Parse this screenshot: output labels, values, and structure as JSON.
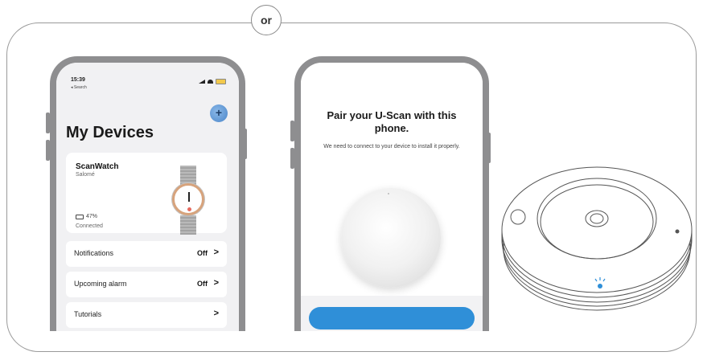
{
  "separator": {
    "label": "or"
  },
  "phone1": {
    "status": {
      "time": "15:39",
      "back": "◂ Search"
    },
    "add_button_icon": "plus-icon",
    "title": "My Devices",
    "device": {
      "name": "ScanWatch",
      "owner": "Salomé",
      "battery": "47%",
      "status": "Connected"
    },
    "menu": [
      {
        "label": "Notifications",
        "value": "Off"
      },
      {
        "label": "Upcoming alarm",
        "value": "Off"
      },
      {
        "label": "Tutorials",
        "value": ""
      }
    ],
    "colors": {
      "accent": "#4b86c9",
      "watch_case": "#d7a37c"
    }
  },
  "phone2": {
    "title": "Pair your U-Scan with this phone.",
    "subtitle": "We need to connect to your device to install it properly.",
    "colors": {
      "button": "#2f8fd8"
    }
  }
}
